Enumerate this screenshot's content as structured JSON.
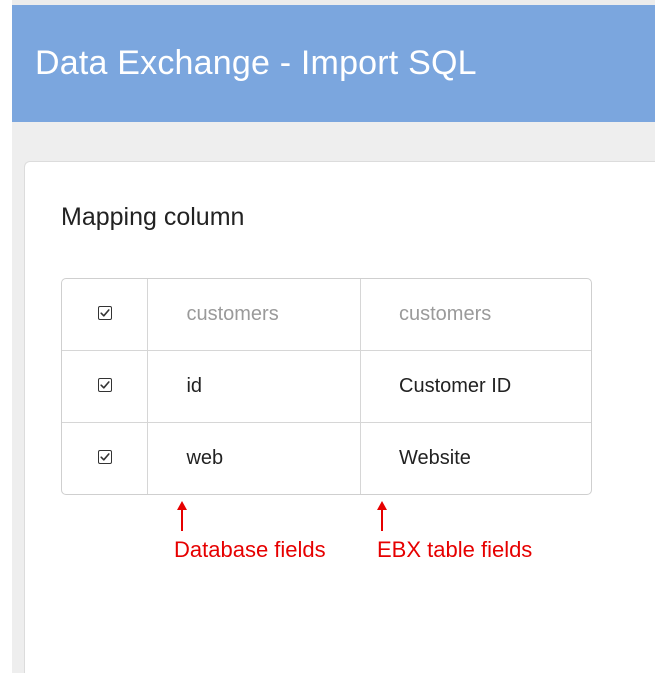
{
  "header": {
    "title": "Data Exchange - Import SQL",
    "background_color": "#7ba6de"
  },
  "section": {
    "title": "Mapping column"
  },
  "table": {
    "header_row": {
      "checked": true,
      "database_table": "customers",
      "ebx_table": "customers"
    },
    "rows": [
      {
        "checked": true,
        "database_field": "id",
        "ebx_field": "Customer ID"
      },
      {
        "checked": true,
        "database_field": "web",
        "ebx_field": "Website"
      }
    ]
  },
  "annotations": {
    "database_label": "Database fields",
    "ebx_label": "EBX table fields",
    "color": "#e60000",
    "icon": "arrow-up-icon"
  }
}
